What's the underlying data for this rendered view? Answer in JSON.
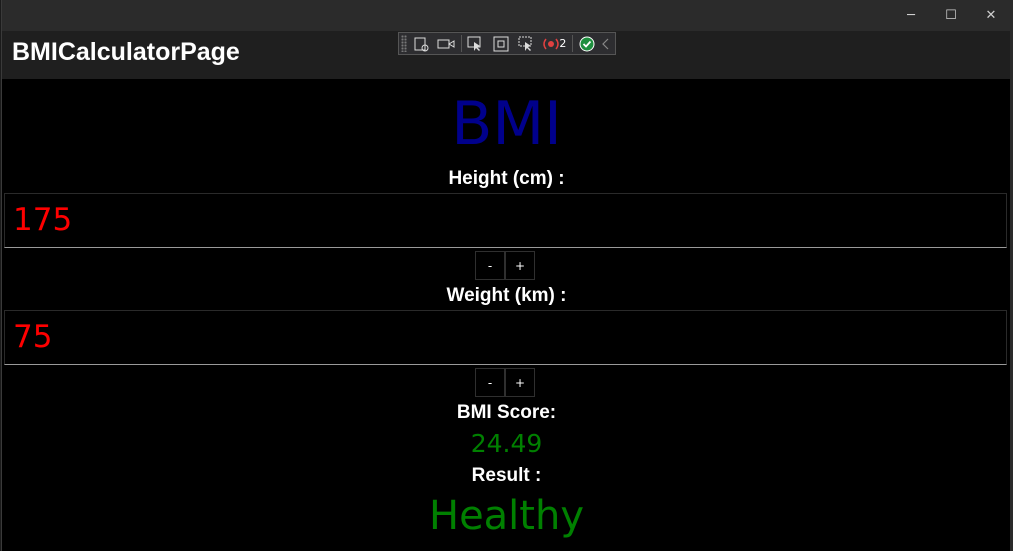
{
  "window": {
    "title": "",
    "controls": {
      "minimize": "─",
      "maximize": "☐",
      "close": "✕"
    }
  },
  "app": {
    "page_title": "BMICalculatorPage"
  },
  "toolbar": {
    "badge_count": "2"
  },
  "main": {
    "heading": "BMI",
    "height": {
      "label": "Height (cm) :",
      "value": "175",
      "decrement": "-",
      "increment": "+"
    },
    "weight": {
      "label": "Weight (km) :",
      "value": "75",
      "decrement": "-",
      "increment": "+"
    },
    "score_label": "BMI Score:",
    "score_value": "24.49",
    "result_label": "Result :",
    "result_value": "Healthy"
  },
  "colors": {
    "heading": "#00008b",
    "input_text": "#ff0000",
    "result": "#008000",
    "background": "#000000"
  }
}
